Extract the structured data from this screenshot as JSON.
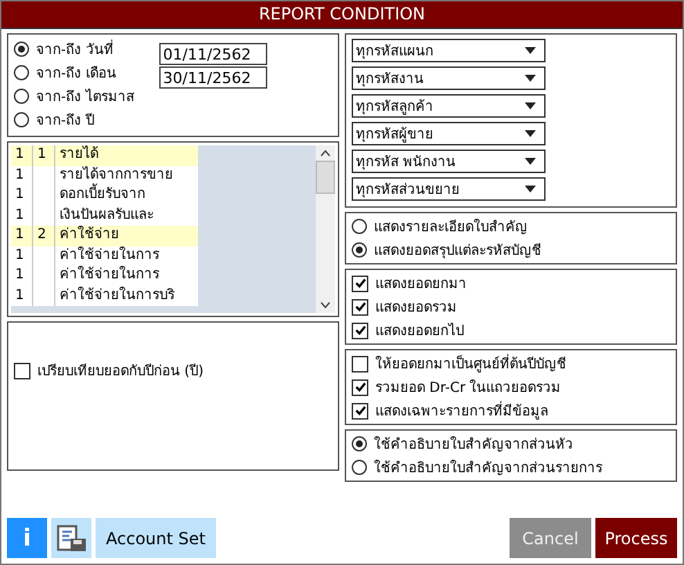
{
  "window": {
    "title": "REPORT CONDITION"
  },
  "period_options": [
    {
      "label": "จาก-ถึง วันที่",
      "selected": true
    },
    {
      "label": "จาก-ถึง เดือน",
      "selected": false
    },
    {
      "label": "จาก-ถึง ไตรมาส",
      "selected": false
    },
    {
      "label": "จาก-ถึง ปี",
      "selected": false
    }
  ],
  "date_fields": [
    {
      "value": "01/11/2562"
    },
    {
      "value": "30/11/2562"
    }
  ],
  "account_list": {
    "rows": [
      {
        "kind": "group",
        "column_1": "1",
        "column_2": "1",
        "column_3": "รายได้"
      },
      {
        "kind": "item",
        "column_1": "1",
        "column_3": "รายได้จากการขาย"
      },
      {
        "kind": "item",
        "column_1": "1",
        "column_3": "ดอกเบี้ยรับจาก"
      },
      {
        "kind": "item",
        "column_1": "1",
        "column_3": "เงินปันผลรับและ"
      },
      {
        "kind": "group",
        "column_1": "1",
        "column_2": "2",
        "column_3": "ค่าใช้จ่าย"
      },
      {
        "kind": "item",
        "column_1": "1",
        "column_3": "ค่าใช้จ่ายในการ"
      },
      {
        "kind": "item",
        "column_1": "1",
        "column_3": "ค่าใช้จ่ายในการ"
      },
      {
        "kind": "item",
        "column_1": "1",
        "column_3": "ค่าใช้จ่ายในการบริ"
      }
    ]
  },
  "compare_option": {
    "label": "เปรียบเทียบยอดกับปีก่อน (ปี)",
    "checked": false
  },
  "filters": [
    {
      "value": "ทุกรหัสแผนก"
    },
    {
      "value": "ทุกรหัสงาน"
    },
    {
      "value": "ทุกรหัสลูกค้า"
    },
    {
      "value": "ทุกรหัสผู้ขาย"
    },
    {
      "value": "ทุกรหัส พนักงาน"
    },
    {
      "value": "ทุกรหัสส่วนขยาย"
    }
  ],
  "detail_options": [
    {
      "label": "แสดงรายละเอียดใบสำคัญ",
      "selected": false
    },
    {
      "label": "แสดงยอดสรุปแต่ละรหัสบัญชี",
      "selected": true
    }
  ],
  "balance_options": [
    {
      "label": "แสดงยอดยกมา",
      "checked": true
    },
    {
      "label": "แสดงยอดรวม",
      "checked": true
    },
    {
      "label": "แสดงยอดยกไป",
      "checked": true
    }
  ],
  "other_options": [
    {
      "label": "ให้ยอดยกมาเป็นศูนย์ที่ต้นปีบัญชี",
      "checked": false
    },
    {
      "label": "รวมยอด Dr-Cr ในแถวยอดรวม",
      "checked": true
    },
    {
      "label": "แสดงเฉพาะรายการที่มีข้อมูล",
      "checked": true
    }
  ],
  "description_options": [
    {
      "label": "ใช้คำอธิบายใบสำคัญจากส่วนหัว",
      "selected": true
    },
    {
      "label": "ใช้คำอธิบายใบสำคัญจากส่วนรายการ",
      "selected": false
    }
  ],
  "buttons": [
    {
      "kind": "info",
      "label": "i"
    },
    {
      "kind": "save-icon"
    },
    {
      "kind": "text",
      "label": "Account Set"
    },
    {
      "kind": "cancel",
      "label": "Cancel"
    },
    {
      "kind": "process",
      "label": "Process"
    }
  ]
}
